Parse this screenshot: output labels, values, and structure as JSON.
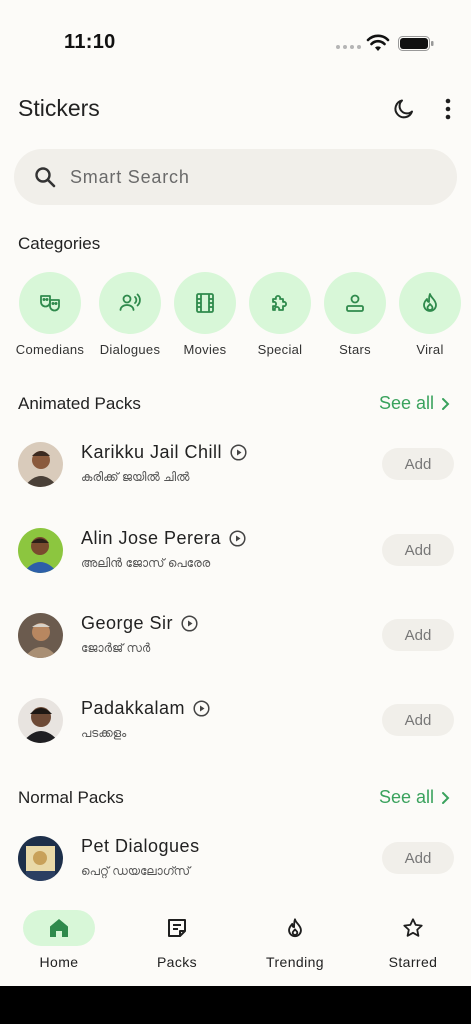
{
  "status_bar": {
    "time": "11:10"
  },
  "header": {
    "title": "Stickers"
  },
  "search": {
    "placeholder": "Smart Search"
  },
  "categories": {
    "title": "Categories",
    "items": [
      {
        "label": "Comedians",
        "icon": "masks-icon"
      },
      {
        "label": "Dialogues",
        "icon": "speaking-person-icon"
      },
      {
        "label": "Movies",
        "icon": "film-icon"
      },
      {
        "label": "Special",
        "icon": "puzzle-icon"
      },
      {
        "label": "Stars",
        "icon": "person-badge-icon"
      },
      {
        "label": "Viral",
        "icon": "flame-icon"
      }
    ]
  },
  "animated_packs": {
    "title": "Animated Packs",
    "see_all": "See all",
    "items": [
      {
        "name": "Karikku Jail Chill",
        "subtitle": "കരിക്ക് ജയിൽ ചിൽ",
        "action": "Add"
      },
      {
        "name": "Alin Jose Perera",
        "subtitle": "അലിൻ ജോസ് പെരേര",
        "action": "Add"
      },
      {
        "name": "George Sir",
        "subtitle": "ജോർജ് സർ",
        "action": "Add"
      },
      {
        "name": "Padakkalam",
        "subtitle": "പടക്കളം",
        "action": "Add"
      }
    ]
  },
  "normal_packs": {
    "title": "Normal Packs",
    "see_all": "See all",
    "items": [
      {
        "name": "Pet Dialogues",
        "subtitle": "പെറ്റ് ഡയലോഗ്സ്",
        "action": "Add"
      }
    ]
  },
  "bottom_nav": {
    "items": [
      {
        "label": "Home",
        "icon": "home-icon",
        "active": true
      },
      {
        "label": "Packs",
        "icon": "packs-icon",
        "active": false
      },
      {
        "label": "Trending",
        "icon": "flame-icon",
        "active": false
      },
      {
        "label": "Starred",
        "icon": "star-icon",
        "active": false
      }
    ]
  },
  "colors": {
    "accent": "#3aa25d",
    "chip_bg": "#d8f7d8",
    "icon_green": "#2f8a4c",
    "background": "#fcfbf8"
  }
}
